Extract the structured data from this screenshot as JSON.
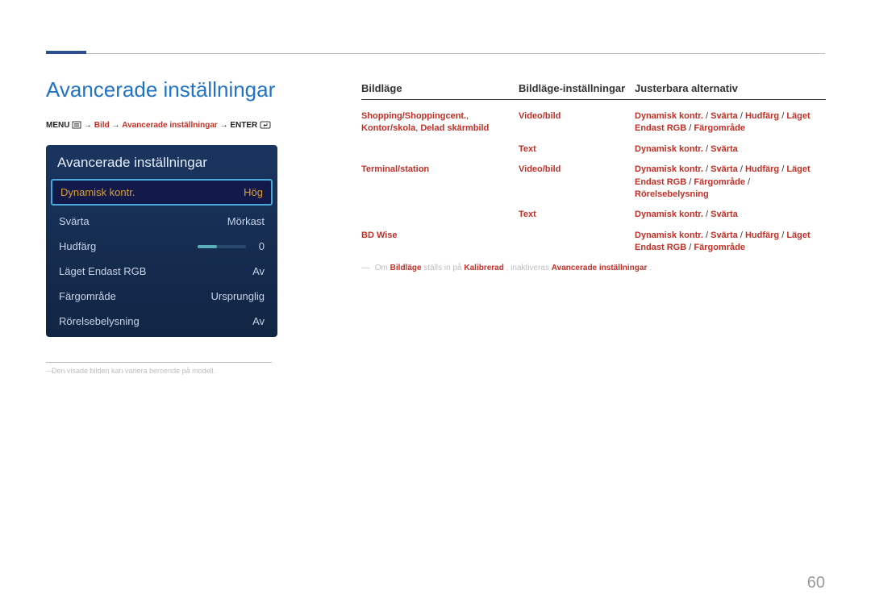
{
  "page_title": "Avancerade inställningar",
  "breadcrumb": {
    "menu_label": "MENU",
    "arrow": "→",
    "step1": "Bild",
    "step2": "Avancerade inställningar",
    "enter_label": "ENTER"
  },
  "panel": {
    "title": "Avancerade inställningar",
    "rows": [
      {
        "label": "Dynamisk kontr.",
        "value": "Hög",
        "selected": true
      },
      {
        "label": "Svärta",
        "value": "Mörkast"
      },
      {
        "label": "Hudfärg",
        "value": "0",
        "slider": true
      },
      {
        "label": "Läget Endast RGB",
        "value": "Av"
      },
      {
        "label": "Färgområde",
        "value": "Ursprunglig"
      },
      {
        "label": "Rörelsebelysning",
        "value": "Av"
      }
    ]
  },
  "footnote": "Den visade bilden kan variera beroende på modell.",
  "table": {
    "headers": {
      "col1": "Bildläge",
      "col2": "Bildläge-inställningar",
      "col3": "Justerbara alternativ"
    },
    "rows": [
      {
        "c1": "Shopping/Shoppingcent., Kontor/skola, Delad skärmbild",
        "c2": "Video/bild",
        "c3_parts": [
          "Dynamisk kontr.",
          " / ",
          "Svärta",
          " / ",
          "Hudfärg",
          " / ",
          "Läget Endast RGB",
          " / ",
          "Färgområde"
        ]
      },
      {
        "c1": "",
        "c2": "Text",
        "c3_parts": [
          "Dynamisk kontr.",
          " / ",
          "Svärta"
        ]
      },
      {
        "c1": "Terminal/station",
        "c2": "Video/bild",
        "c3_parts": [
          "Dynamisk kontr.",
          " / ",
          "Svärta",
          " / ",
          "Hudfärg",
          " / ",
          "Läget Endast RGB",
          " / ",
          "Färgområde",
          " / ",
          "Rörelsebelysning"
        ]
      },
      {
        "c1": "",
        "c2": "Text",
        "c3_parts": [
          "Dynamisk kontr.",
          " / ",
          "Svärta"
        ]
      },
      {
        "c1": "BD Wise",
        "c2": "",
        "c3_parts": [
          "Dynamisk kontr.",
          " / ",
          "Svärta",
          " / ",
          "Hudfärg",
          " / ",
          "Läget Endast RGB",
          " / ",
          "Färgområde"
        ]
      }
    ]
  },
  "note": {
    "prefix": "Om ",
    "b1": "Bildläge",
    "mid": " ställs in på ",
    "b2": "Kalibrerad",
    "mid2": ", inaktiveras ",
    "b3": "Avancerade inställningar",
    "suffix": "."
  },
  "page_number": "60"
}
